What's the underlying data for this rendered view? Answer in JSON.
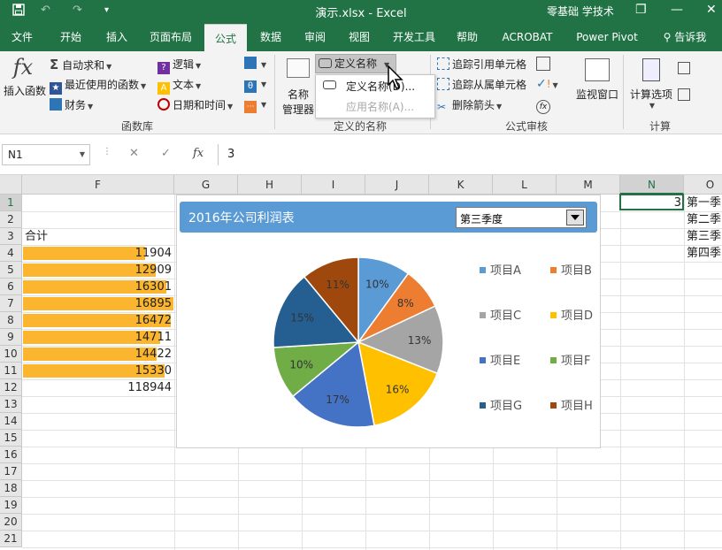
{
  "titlebar": {
    "save_icon": "save-icon",
    "title": "演示.xlsx  -  Excel",
    "user": "零基础 学技术",
    "restore": "❐",
    "minimize": "—",
    "close": "✕"
  },
  "tabs": [
    "文件",
    "开始",
    "插入",
    "页面布局",
    "公式",
    "数据",
    "审阅",
    "视图",
    "开发工具",
    "帮助",
    "ACROBAT",
    "Power Pivot"
  ],
  "active_tab": "公式",
  "tell_me": "告诉我",
  "ribbon": {
    "insert_function": "插入函数",
    "autosum": "自动求和",
    "recent": "最近使用的函数",
    "financial": "财务",
    "logical": "逻辑",
    "text": "文本",
    "datetime": "日期和时间",
    "function_library": "函数库",
    "name_manager_1": "名称",
    "name_manager_2": "管理器",
    "define_name": "定义名称",
    "defined_names": "定义的名称",
    "trace_precedents": "追踪引用单元格",
    "trace_dependents": "追踪从属单元格",
    "remove_arrows": "删除箭头",
    "formula_auditing": "公式审核",
    "watch_window": "监视窗口",
    "calc_options": "计算选项",
    "calculation": "计算"
  },
  "dropdown": {
    "item1": "定义名称(D)...",
    "item2": "应用名称(A)..."
  },
  "formula_bar": {
    "name_box": "N1",
    "cancel": "✕",
    "enter": "✓",
    "fx": "fx",
    "value": "3"
  },
  "columns": [
    "F",
    "G",
    "H",
    "I",
    "J",
    "K",
    "L",
    "M",
    "N",
    "O"
  ],
  "rows": [
    "1",
    "2",
    "3",
    "4",
    "5",
    "6",
    "7",
    "8",
    "9",
    "10",
    "11",
    "12",
    "13",
    "14",
    "15",
    "16",
    "17",
    "18",
    "19",
    "20",
    "21"
  ],
  "sheet": {
    "total_label": "合计",
    "values": [
      "11904",
      "12909",
      "16301",
      "16895",
      "16472",
      "14711",
      "14422",
      "15330"
    ],
    "bar_fractions": [
      0.81,
      0.88,
      0.95,
      1.0,
      0.98,
      0.91,
      0.89,
      0.94
    ],
    "total": "118944",
    "n1": "3",
    "o_col": [
      "第一季",
      "第二季",
      "第三季",
      "第四季"
    ]
  },
  "chart_data": {
    "type": "pie",
    "title": "2016年公司利润表",
    "selector": "第三季度",
    "categories": [
      "项目A",
      "项目B",
      "项目C",
      "项目D",
      "项目E",
      "项目F",
      "项目G",
      "项目H"
    ],
    "values": [
      10,
      8,
      13,
      16,
      17,
      10,
      15,
      11
    ],
    "labels": [
      "10%",
      "8%",
      "13%",
      "16%",
      "17%",
      "10%",
      "15%",
      "11%"
    ],
    "colors": [
      "#5b9bd5",
      "#ed7d31",
      "#a5a5a5",
      "#ffc000",
      "#4472c4",
      "#70ad47",
      "#255e91",
      "#9e480e"
    ],
    "legend_position": "right"
  }
}
